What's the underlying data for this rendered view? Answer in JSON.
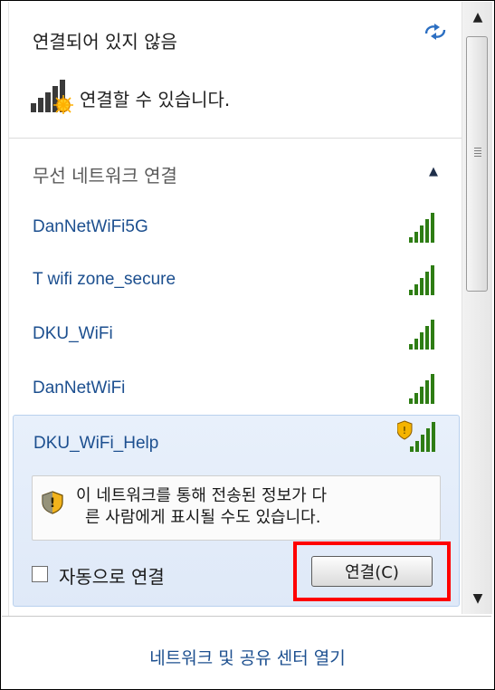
{
  "status": {
    "title": "연결되어 있지 않음",
    "connectivity_text": "연결할 수 있습니다."
  },
  "wireless_section": {
    "title": "무선 네트워크 연결"
  },
  "networks": [
    {
      "name": "DanNetWiFi5G",
      "secured": false
    },
    {
      "name": "T wifi zone_secure",
      "secured": false
    },
    {
      "name": "DKU_WiFi",
      "secured": false
    },
    {
      "name": "DanNetWiFi",
      "secured": false
    }
  ],
  "expanded_network": {
    "name": "DKU_WiFi_Help",
    "warning_line1": "이 네트워크를 통해 전송된 정보가 다",
    "warning_line2": "른 사람에게 표시될 수도 있습니다.",
    "auto_connect_label": "자동으로 연결",
    "auto_connect_checked": false,
    "connect_button_label": "연결(C)"
  },
  "footer": {
    "link": "네트워크 및 공유 센터 열기"
  },
  "colors": {
    "link_blue": "#1c4f8f",
    "signal_green": "#2e7d14",
    "highlight_red": "#ff0000",
    "expanded_bg": "#e4edf9"
  },
  "icons": {
    "refresh": "refresh-icon",
    "collapse": "chevron-up-icon",
    "signal": "signal-bars-icon",
    "shield": "security-shield-icon"
  }
}
